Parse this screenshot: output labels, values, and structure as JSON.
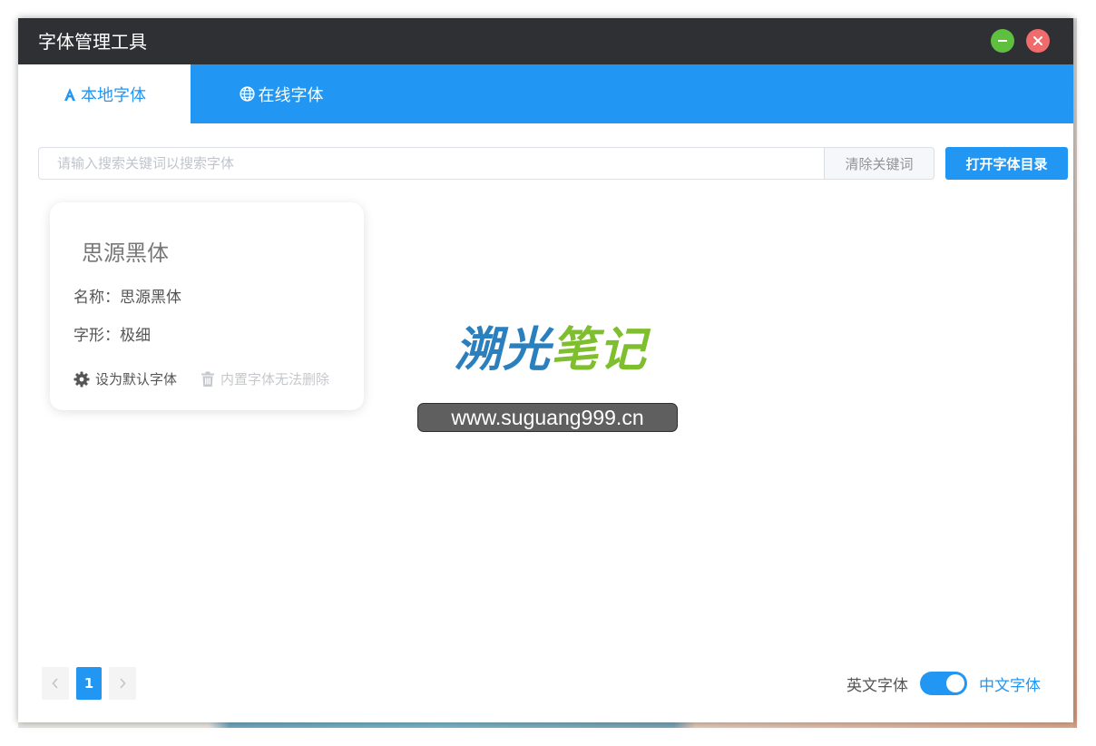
{
  "window": {
    "title": "字体管理工具",
    "minimize_icon": "minus-icon",
    "close_icon": "close-icon"
  },
  "tabs": [
    {
      "label": "本地字体",
      "icon": "font-letter-icon",
      "active": true
    },
    {
      "label": "在线字体",
      "icon": "globe-icon",
      "active": false
    }
  ],
  "search": {
    "placeholder": "请输入搜索关键词以搜索字体",
    "value": "",
    "clear_label": "清除关键词",
    "open_dir_label": "打开字体目录"
  },
  "fonts": [
    {
      "preview": "思源黑体",
      "name_line": "名称：思源黑体",
      "style_line": "字形：极细",
      "set_default_label": "设为默认字体",
      "delete_label": "内置字体无法删除"
    }
  ],
  "watermark": {
    "title_part1": "溯光",
    "title_part2": "笔记",
    "url": "www.suguang999.cn"
  },
  "pagination": {
    "current": "1",
    "prev_icon": "chevron-left-icon",
    "next_icon": "chevron-right-icon"
  },
  "language": {
    "en_label": "英文字体",
    "zh_label": "中文字体",
    "toggle_on": true
  },
  "colors": {
    "accent": "#2196f3",
    "titlebar": "#2f3034",
    "minimize": "#5fbf3f",
    "close": "#f06b6b"
  }
}
